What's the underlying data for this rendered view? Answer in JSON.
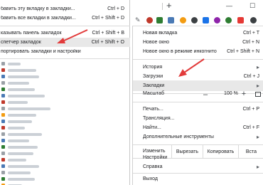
{
  "bookmarks_submenu": {
    "items": [
      {
        "label": "бавить эту вкладку в закладки...",
        "shortcut": "Ctrl + D"
      },
      {
        "label": "бавить все вкладки в закладки...",
        "shortcut": "Ctrl + Shift + D"
      },
      {
        "label": "казывать панель закладок",
        "shortcut": "Ctrl + Shift + B"
      },
      {
        "label": "спетчер закладок",
        "shortcut": "Ctrl + Shift + O"
      },
      {
        "label": "портировать закладки и настройки",
        "shortcut": ""
      }
    ]
  },
  "bookmarks_list": {
    "favicon_colors": [
      "#9aa0a6",
      "#c0392b",
      "#4a7ab5",
      "#9aa0a6",
      "#2e7d32",
      "#4a7ab5",
      "#c0392b",
      "#9aa0a6",
      "#f39c12",
      "#4a7ab5",
      "#c0392b",
      "#9aa0a6",
      "#4a7ab5",
      "#2e7d32",
      "#9aa0a6",
      "#c0392b",
      "#4a7ab5",
      "#9aa0a6",
      "#2e7d32",
      "#f39c12"
    ]
  },
  "chrome_menu": {
    "new_tab": "Новая вкладка",
    "new_tab_shortcut": "Ctrl + T",
    "new_window": "Новое окно",
    "new_window_shortcut": "Ctrl + N",
    "incognito": "Новое окно в режиме инкогнито",
    "incognito_shortcut": "Ctrl + Shift + N",
    "history": "История",
    "downloads": "Загрузки",
    "downloads_shortcut": "Ctrl + J",
    "bookmarks": "Закладки",
    "zoom_label": "Масштаб",
    "zoom_minus": "–",
    "zoom_value": "100 %",
    "zoom_plus": "+",
    "print": "Печать...",
    "print_shortcut": "Ctrl + P",
    "cast": "Трансляция...",
    "find": "Найти...",
    "find_shortcut": "Ctrl + F",
    "more_tools": "Дополнительные инструменты",
    "edit_label": "Изменить",
    "cut": "Вырезать",
    "copy": "Копировать",
    "paste": "Вста",
    "settings": "Настройки",
    "help": "Справка",
    "exit": "Выход"
  },
  "toolbar": {
    "new_tab_plus": "+",
    "minimize": "—",
    "maximize": "☐"
  },
  "colors": {
    "highlight": "#e8e8e8",
    "arrow": "#e23b3b"
  }
}
